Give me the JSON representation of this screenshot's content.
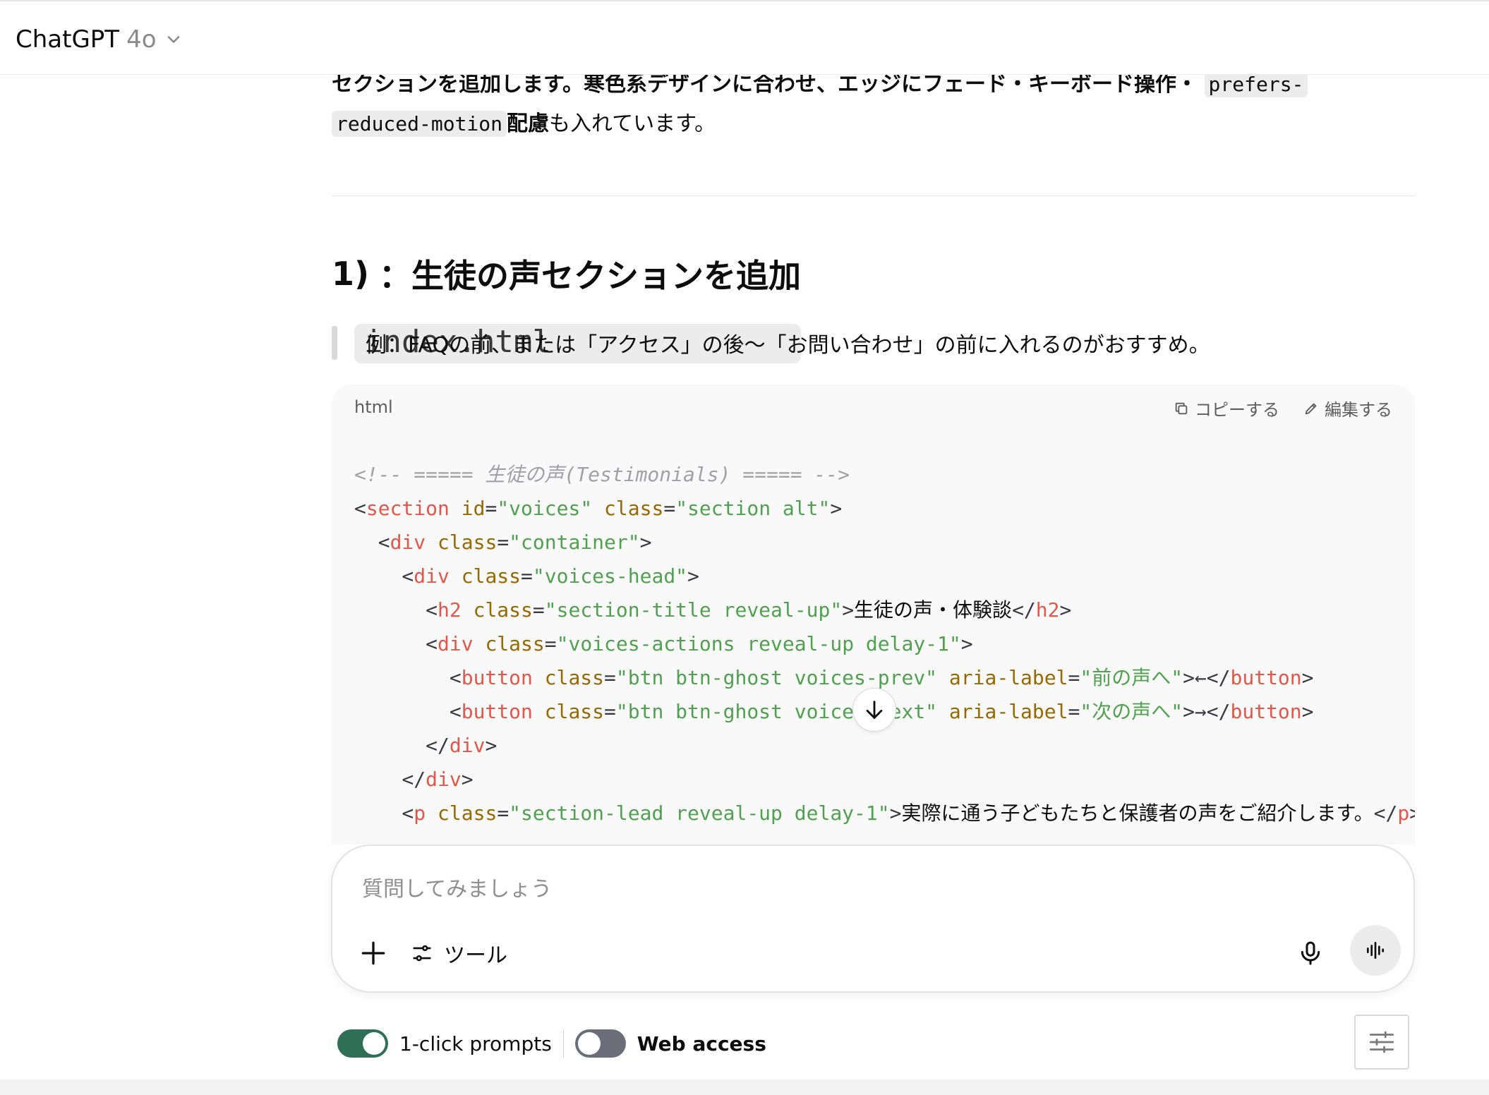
{
  "header": {
    "model_name": "ChatGPT",
    "model_version": "4o"
  },
  "message": {
    "intro_line1": "セクションを追加します。寒色系デザインに合わせ、エッジにフェード・キーボード操作・",
    "intro_code1": "prefers-",
    "intro_code2": "reduced-motion",
    "intro_bold": "配慮",
    "intro_rest": "も入れています。",
    "heading_num": "1)",
    "heading_code": "index.html",
    "heading_rest": "：生徒の声セクションを追加",
    "quote": "例：FAQの前、または「アクセス」の後〜「お問い合わせ」の前に入れるのがおすすめ。"
  },
  "codeblock": {
    "lang": "html",
    "copy_label": "コピーする",
    "edit_label": "編集する",
    "lines": [
      [
        {
          "c": "c-com",
          "t": "<!-- ===== 生徒の声(Testimonials) ===== -->"
        }
      ],
      [
        {
          "c": "c-pun",
          "t": "<"
        },
        {
          "c": "c-tag",
          "t": "section"
        },
        {
          "c": "c-pun",
          "t": " "
        },
        {
          "c": "c-attr",
          "t": "id"
        },
        {
          "c": "c-pun",
          "t": "="
        },
        {
          "c": "c-str",
          "t": "\"voices\""
        },
        {
          "c": "c-pun",
          "t": " "
        },
        {
          "c": "c-attr",
          "t": "class"
        },
        {
          "c": "c-pun",
          "t": "="
        },
        {
          "c": "c-str",
          "t": "\"section alt\""
        },
        {
          "c": "c-pun",
          "t": ">"
        }
      ],
      [
        {
          "c": "c-pun",
          "t": "  <"
        },
        {
          "c": "c-tag",
          "t": "div"
        },
        {
          "c": "c-pun",
          "t": " "
        },
        {
          "c": "c-attr",
          "t": "class"
        },
        {
          "c": "c-pun",
          "t": "="
        },
        {
          "c": "c-str",
          "t": "\"container\""
        },
        {
          "c": "c-pun",
          "t": ">"
        }
      ],
      [
        {
          "c": "c-pun",
          "t": "    <"
        },
        {
          "c": "c-tag",
          "t": "div"
        },
        {
          "c": "c-pun",
          "t": " "
        },
        {
          "c": "c-attr",
          "t": "class"
        },
        {
          "c": "c-pun",
          "t": "="
        },
        {
          "c": "c-str",
          "t": "\"voices-head\""
        },
        {
          "c": "c-pun",
          "t": ">"
        }
      ],
      [
        {
          "c": "c-pun",
          "t": "      <"
        },
        {
          "c": "c-tag",
          "t": "h2"
        },
        {
          "c": "c-pun",
          "t": " "
        },
        {
          "c": "c-attr",
          "t": "class"
        },
        {
          "c": "c-pun",
          "t": "="
        },
        {
          "c": "c-str",
          "t": "\"section-title reveal-up\""
        },
        {
          "c": "c-pun",
          "t": ">"
        },
        {
          "c": "c-txt",
          "t": "生徒の声・体験談"
        },
        {
          "c": "c-pun",
          "t": "</"
        },
        {
          "c": "c-tag",
          "t": "h2"
        },
        {
          "c": "c-pun",
          "t": ">"
        }
      ],
      [
        {
          "c": "c-pun",
          "t": "      <"
        },
        {
          "c": "c-tag",
          "t": "div"
        },
        {
          "c": "c-pun",
          "t": " "
        },
        {
          "c": "c-attr",
          "t": "class"
        },
        {
          "c": "c-pun",
          "t": "="
        },
        {
          "c": "c-str",
          "t": "\"voices-actions reveal-up delay-1\""
        },
        {
          "c": "c-pun",
          "t": ">"
        }
      ],
      [
        {
          "c": "c-pun",
          "t": "        <"
        },
        {
          "c": "c-tag",
          "t": "button"
        },
        {
          "c": "c-pun",
          "t": " "
        },
        {
          "c": "c-attr",
          "t": "class"
        },
        {
          "c": "c-pun",
          "t": "="
        },
        {
          "c": "c-str",
          "t": "\"btn btn-ghost voices-prev\""
        },
        {
          "c": "c-pun",
          "t": " "
        },
        {
          "c": "c-attr",
          "t": "aria-label"
        },
        {
          "c": "c-pun",
          "t": "="
        },
        {
          "c": "c-str",
          "t": "\"前の声へ\""
        },
        {
          "c": "c-pun",
          "t": ">←</"
        },
        {
          "c": "c-tag",
          "t": "button"
        },
        {
          "c": "c-pun",
          "t": ">"
        }
      ],
      [
        {
          "c": "c-pun",
          "t": "        <"
        },
        {
          "c": "c-tag",
          "t": "button"
        },
        {
          "c": "c-pun",
          "t": " "
        },
        {
          "c": "c-attr",
          "t": "class"
        },
        {
          "c": "c-pun",
          "t": "="
        },
        {
          "c": "c-str",
          "t": "\"btn btn-ghost voices-next\""
        },
        {
          "c": "c-pun",
          "t": " "
        },
        {
          "c": "c-attr",
          "t": "aria-label"
        },
        {
          "c": "c-pun",
          "t": "="
        },
        {
          "c": "c-str",
          "t": "\"次の声へ\""
        },
        {
          "c": "c-pun",
          "t": ">→</"
        },
        {
          "c": "c-tag",
          "t": "button"
        },
        {
          "c": "c-pun",
          "t": ">"
        }
      ],
      [
        {
          "c": "c-pun",
          "t": "      </"
        },
        {
          "c": "c-tag",
          "t": "div"
        },
        {
          "c": "c-pun",
          "t": ">"
        }
      ],
      [
        {
          "c": "c-pun",
          "t": "    </"
        },
        {
          "c": "c-tag",
          "t": "div"
        },
        {
          "c": "c-pun",
          "t": ">"
        }
      ],
      [
        {
          "c": "c-pun",
          "t": "    <"
        },
        {
          "c": "c-tag",
          "t": "p"
        },
        {
          "c": "c-pun",
          "t": " "
        },
        {
          "c": "c-attr",
          "t": "class"
        },
        {
          "c": "c-pun",
          "t": "="
        },
        {
          "c": "c-str",
          "t": "\"section-lead reveal-up delay-1\""
        },
        {
          "c": "c-pun",
          "t": ">"
        },
        {
          "c": "c-txt",
          "t": "実際に通う子どもたちと保護者の声をご紹介します。"
        },
        {
          "c": "c-pun",
          "t": "</"
        },
        {
          "c": "c-tag",
          "t": "p"
        },
        {
          "c": "c-pun",
          "t": ">"
        }
      ]
    ]
  },
  "composer": {
    "placeholder": "質問してみましょう",
    "tools_label": "ツール"
  },
  "toggles": {
    "one_click_label": "1-click prompts",
    "one_click_on": true,
    "web_access_label": "Web access",
    "web_access_on": false
  },
  "icons": {
    "chevron": "chevron-down-icon",
    "copy": "copy-icon",
    "edit": "pencil-icon",
    "scroll": "arrow-down-icon",
    "plus": "plus-icon",
    "tools": "sliders-icon",
    "mic": "microphone-icon",
    "voice": "waveform-icon",
    "settings": "sliders-icon"
  },
  "colors": {
    "toggle_on": "#2f6f57",
    "toggle_off": "#6b6e78"
  }
}
